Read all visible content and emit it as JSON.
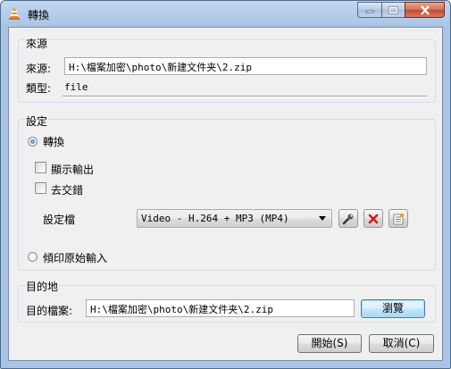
{
  "window": {
    "title": "轉換",
    "icon": "vlc-cone-icon"
  },
  "source": {
    "group_label": "來源",
    "path_label": "來源:",
    "path_value": "H:\\檔案加密\\photo\\新建文件夹\\2.zip",
    "type_label": "類型:",
    "type_value": "file"
  },
  "settings": {
    "group_label": "設定",
    "convert_label": "轉換",
    "convert_selected": true,
    "show_output_label": "顯示輸出",
    "show_output_checked": false,
    "deinterlace_label": "去交錯",
    "deinterlace_checked": false,
    "profile_label": "設定檔",
    "profile_value": "Video - H.264 + MP3 (MP4)",
    "dump_raw_label": "傾印原始輸入",
    "dump_raw_selected": false
  },
  "destination": {
    "group_label": "目的地",
    "file_label": "目的檔案:",
    "file_value": "H:\\檔案加密\\photo\\新建文件夹\\2.zip",
    "browse_label": "瀏覽"
  },
  "actions": {
    "start_label": "開始(S)",
    "cancel_label": "取消(C)"
  }
}
